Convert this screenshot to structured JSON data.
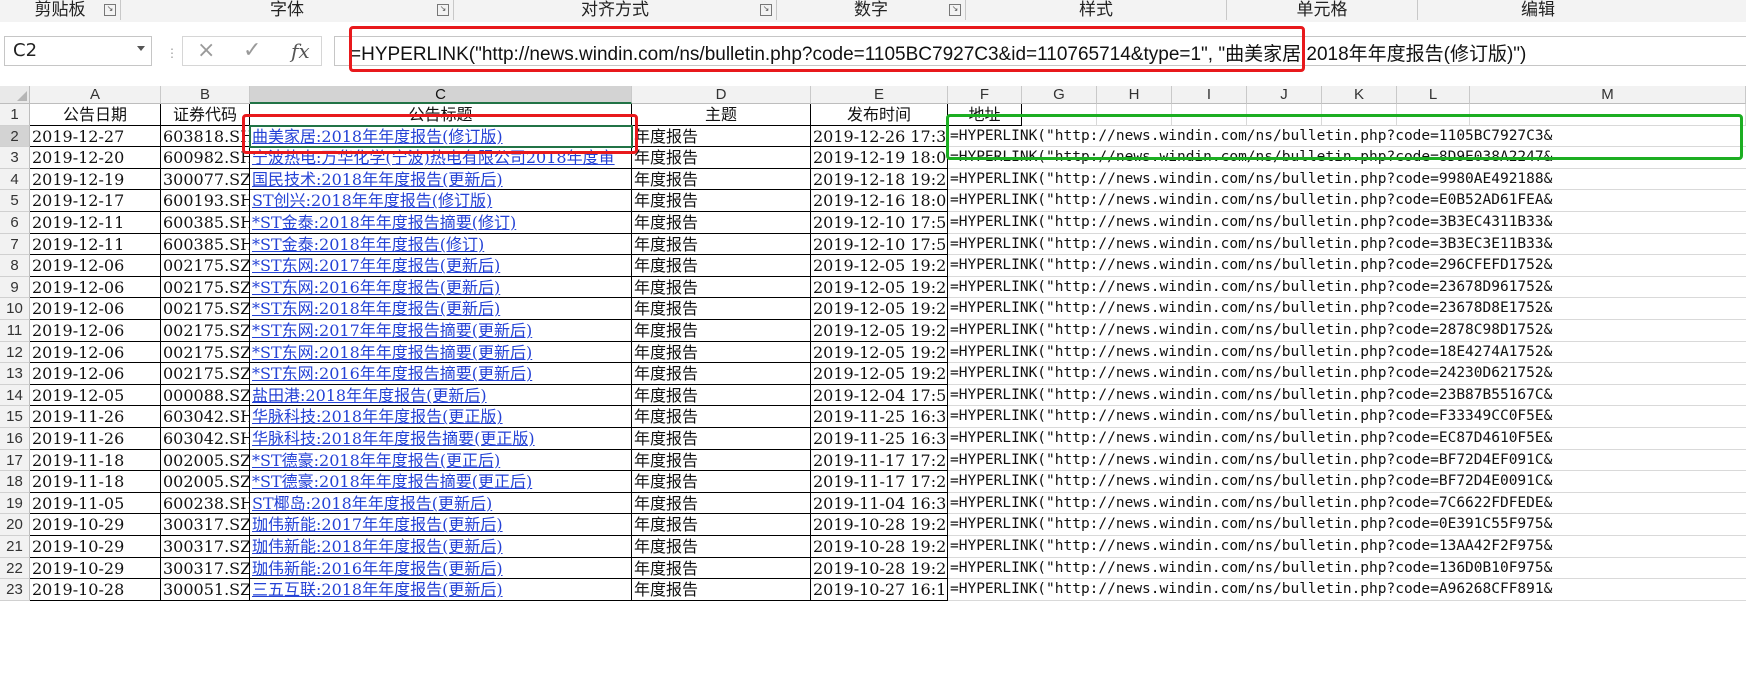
{
  "ribbon": {
    "groups": [
      "剪贴板",
      "字体",
      "对齐方式",
      "数字",
      "样式",
      "单元格",
      "编辑"
    ]
  },
  "formula_bar": {
    "name_box": "C2",
    "cancel_icon": "×",
    "enter_icon": "✓",
    "fx_label": "fx",
    "formula": "=HYPERLINK(\"http://news.windin.com/ns/bulletin.php?code=1105BC7927C3&id=110765714&type=1\", \"曲美家居:2018年年度报告(修订版)\")"
  },
  "columns": [
    "A",
    "B",
    "C",
    "D",
    "E",
    "F",
    "G",
    "H",
    "I",
    "J",
    "K",
    "L",
    "M"
  ],
  "header_row": [
    "公告日期",
    "证券代码",
    "公告标题",
    "主题",
    "发布时间",
    "地址"
  ],
  "selected_cell": "C2",
  "rows": [
    {
      "num": "2",
      "date": "2019-12-27",
      "code": "603818.SH",
      "title": "曲美家居:2018年年度报告(修订版)",
      "topic": "年度报告",
      "time": "2019-12-26 17:3",
      "formula": "=HYPERLINK(\"http://news.windin.com/ns/bulletin.php?code=1105BC7927C3&"
    },
    {
      "num": "3",
      "date": "2019-12-20",
      "code": "600982.SH",
      "title": "宁波热电:万华化学(宁波)热电有限公司2018年度审",
      "topic": "年度报告",
      "time": "2019-12-19 18:0",
      "formula": "=HYPERLINK(\"http://news.windin.com/ns/bulletin.php?code=8D9E038A2247&"
    },
    {
      "num": "4",
      "date": "2019-12-19",
      "code": "300077.SZ",
      "title": "国民技术:2018年年度报告(更新后)",
      "topic": "年度报告",
      "time": "2019-12-18 19:2",
      "formula": "=HYPERLINK(\"http://news.windin.com/ns/bulletin.php?code=9980AE492188&"
    },
    {
      "num": "5",
      "date": "2019-12-17",
      "code": "600193.SH",
      "title": "ST创兴:2018年年度报告(修订版)",
      "topic": "年度报告",
      "time": "2019-12-16 18:0",
      "formula": "=HYPERLINK(\"http://news.windin.com/ns/bulletin.php?code=E0B52AD61FEA&"
    },
    {
      "num": "6",
      "date": "2019-12-11",
      "code": "600385.SH",
      "title": "*ST金泰:2018年年度报告摘要(修订)",
      "topic": "年度报告",
      "time": "2019-12-10 17:5",
      "formula": "=HYPERLINK(\"http://news.windin.com/ns/bulletin.php?code=3B3EC4311B33&"
    },
    {
      "num": "7",
      "date": "2019-12-11",
      "code": "600385.SH",
      "title": "*ST金泰:2018年年度报告(修订)",
      "topic": "年度报告",
      "time": "2019-12-10 17:5",
      "formula": "=HYPERLINK(\"http://news.windin.com/ns/bulletin.php?code=3B3EC3E11B33&"
    },
    {
      "num": "8",
      "date": "2019-12-06",
      "code": "002175.SZ",
      "title": "*ST东网:2017年年度报告(更新后)",
      "topic": "年度报告",
      "time": "2019-12-05 19:2",
      "formula": "=HYPERLINK(\"http://news.windin.com/ns/bulletin.php?code=296CFEFD1752&"
    },
    {
      "num": "9",
      "date": "2019-12-06",
      "code": "002175.SZ",
      "title": "*ST东网:2016年年度报告(更新后)",
      "topic": "年度报告",
      "time": "2019-12-05 19:2",
      "formula": "=HYPERLINK(\"http://news.windin.com/ns/bulletin.php?code=23678D961752&"
    },
    {
      "num": "10",
      "date": "2019-12-06",
      "code": "002175.SZ",
      "title": "*ST东网:2018年年度报告(更新后)",
      "topic": "年度报告",
      "time": "2019-12-05 19:2",
      "formula": "=HYPERLINK(\"http://news.windin.com/ns/bulletin.php?code=23678D8E1752&"
    },
    {
      "num": "11",
      "date": "2019-12-06",
      "code": "002175.SZ",
      "title": "*ST东网:2017年年度报告摘要(更新后)",
      "topic": "年度报告",
      "time": "2019-12-05 19:2",
      "formula": "=HYPERLINK(\"http://news.windin.com/ns/bulletin.php?code=2878C98D1752&"
    },
    {
      "num": "12",
      "date": "2019-12-06",
      "code": "002175.SZ",
      "title": "*ST东网:2018年年度报告摘要(更新后)",
      "topic": "年度报告",
      "time": "2019-12-05 19:2",
      "formula": "=HYPERLINK(\"http://news.windin.com/ns/bulletin.php?code=18E4274A1752&"
    },
    {
      "num": "13",
      "date": "2019-12-06",
      "code": "002175.SZ",
      "title": "*ST东网:2016年年度报告摘要(更新后)",
      "topic": "年度报告",
      "time": "2019-12-05 19:2",
      "formula": "=HYPERLINK(\"http://news.windin.com/ns/bulletin.php?code=24230D621752&"
    },
    {
      "num": "14",
      "date": "2019-12-05",
      "code": "000088.SZ",
      "title": "盐田港:2018年年度报告(更新后)",
      "topic": "年度报告",
      "time": "2019-12-04 17:5",
      "formula": "=HYPERLINK(\"http://news.windin.com/ns/bulletin.php?code=23B87B55167C&"
    },
    {
      "num": "15",
      "date": "2019-11-26",
      "code": "603042.SH",
      "title": "华脉科技:2018年年度报告(更正版)",
      "topic": "年度报告",
      "time": "2019-11-25 16:3",
      "formula": "=HYPERLINK(\"http://news.windin.com/ns/bulletin.php?code=F33349CC0F5E&"
    },
    {
      "num": "16",
      "date": "2019-11-26",
      "code": "603042.SH",
      "title": "华脉科技:2018年年度报告摘要(更正版)",
      "topic": "年度报告",
      "time": "2019-11-25 16:3",
      "formula": "=HYPERLINK(\"http://news.windin.com/ns/bulletin.php?code=EC87D4610F5E&"
    },
    {
      "num": "17",
      "date": "2019-11-18",
      "code": "002005.SZ",
      "title": "*ST德豪:2018年年度报告(更正后)",
      "topic": "年度报告",
      "time": "2019-11-17 17:2",
      "formula": "=HYPERLINK(\"http://news.windin.com/ns/bulletin.php?code=BF72D4EF091C&"
    },
    {
      "num": "18",
      "date": "2019-11-18",
      "code": "002005.SZ",
      "title": "*ST德豪:2018年年度报告摘要(更正后)",
      "topic": "年度报告",
      "time": "2019-11-17 17:2",
      "formula": "=HYPERLINK(\"http://news.windin.com/ns/bulletin.php?code=BF72D4E0091C&"
    },
    {
      "num": "19",
      "date": "2019-11-05",
      "code": "600238.SH",
      "title": "ST椰岛:2018年年度报告(更新后)",
      "topic": "年度报告",
      "time": "2019-11-04 16:3",
      "formula": "=HYPERLINK(\"http://news.windin.com/ns/bulletin.php?code=7C6622FDFEDE&"
    },
    {
      "num": "20",
      "date": "2019-10-29",
      "code": "300317.SZ",
      "title": "珈伟新能:2017年年度报告(更新后)",
      "topic": "年度报告",
      "time": "2019-10-28 19:2",
      "formula": "=HYPERLINK(\"http://news.windin.com/ns/bulletin.php?code=0E391C55F975&"
    },
    {
      "num": "21",
      "date": "2019-10-29",
      "code": "300317.SZ",
      "title": "珈伟新能:2018年年度报告(更新后)",
      "topic": "年度报告",
      "time": "2019-10-28 19:2",
      "formula": "=HYPERLINK(\"http://news.windin.com/ns/bulletin.php?code=13AA42F2F975&"
    },
    {
      "num": "22",
      "date": "2019-10-29",
      "code": "300317.SZ",
      "title": "珈伟新能:2016年年度报告(更新后)",
      "topic": "年度报告",
      "time": "2019-10-28 19:2",
      "formula": "=HYPERLINK(\"http://news.windin.com/ns/bulletin.php?code=136D0B10F975&"
    },
    {
      "num": "23",
      "date": "2019-10-28",
      "code": "300051.SZ",
      "title": "三五互联:2018年年度报告(更新后)",
      "topic": "年度报告",
      "time": "2019-10-27 16:1",
      "formula": "=HYPERLINK(\"http://news.windin.com/ns/bulletin.php?code=A96268CFF891&"
    }
  ]
}
